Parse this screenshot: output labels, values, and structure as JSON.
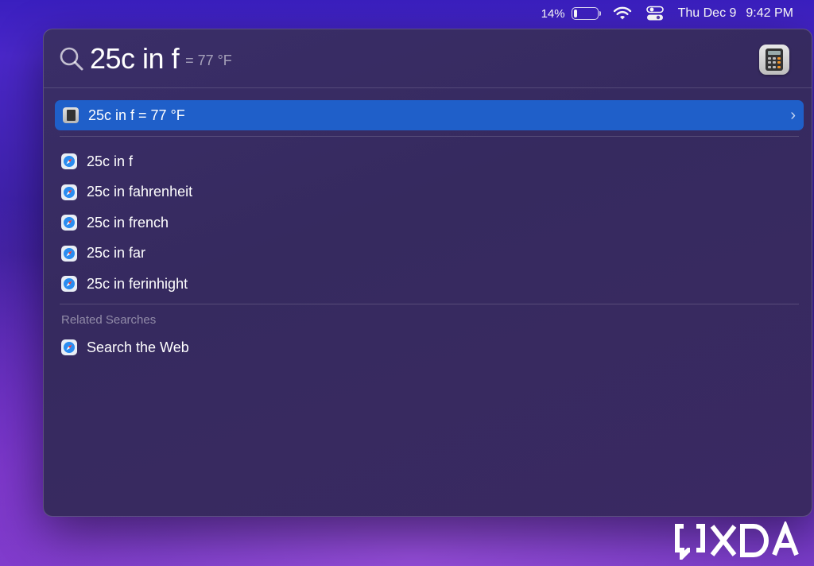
{
  "menubar": {
    "battery_percent": "14%",
    "battery_level": 0.14,
    "date": "Thu Dec 9",
    "time": "9:42 PM"
  },
  "spotlight": {
    "query": "25c in f",
    "completion": "= 77 °F",
    "top_hit": {
      "label": "25c in f = 77 °F",
      "icon": "calculator-icon"
    },
    "suggestions": [
      {
        "label": "25c in f",
        "icon": "safari-icon"
      },
      {
        "label": "25c in fahrenheit",
        "icon": "safari-icon"
      },
      {
        "label": "25c in french",
        "icon": "safari-icon"
      },
      {
        "label": "25c in far",
        "icon": "safari-icon"
      },
      {
        "label": "25c in ferinhight",
        "icon": "safari-icon"
      }
    ],
    "related_header": "Related Searches",
    "web_search_label": "Search the Web"
  },
  "colors": {
    "highlight": "#1f5fc9",
    "panel": "#372b60",
    "wallpaper": "#3a1fbf"
  }
}
